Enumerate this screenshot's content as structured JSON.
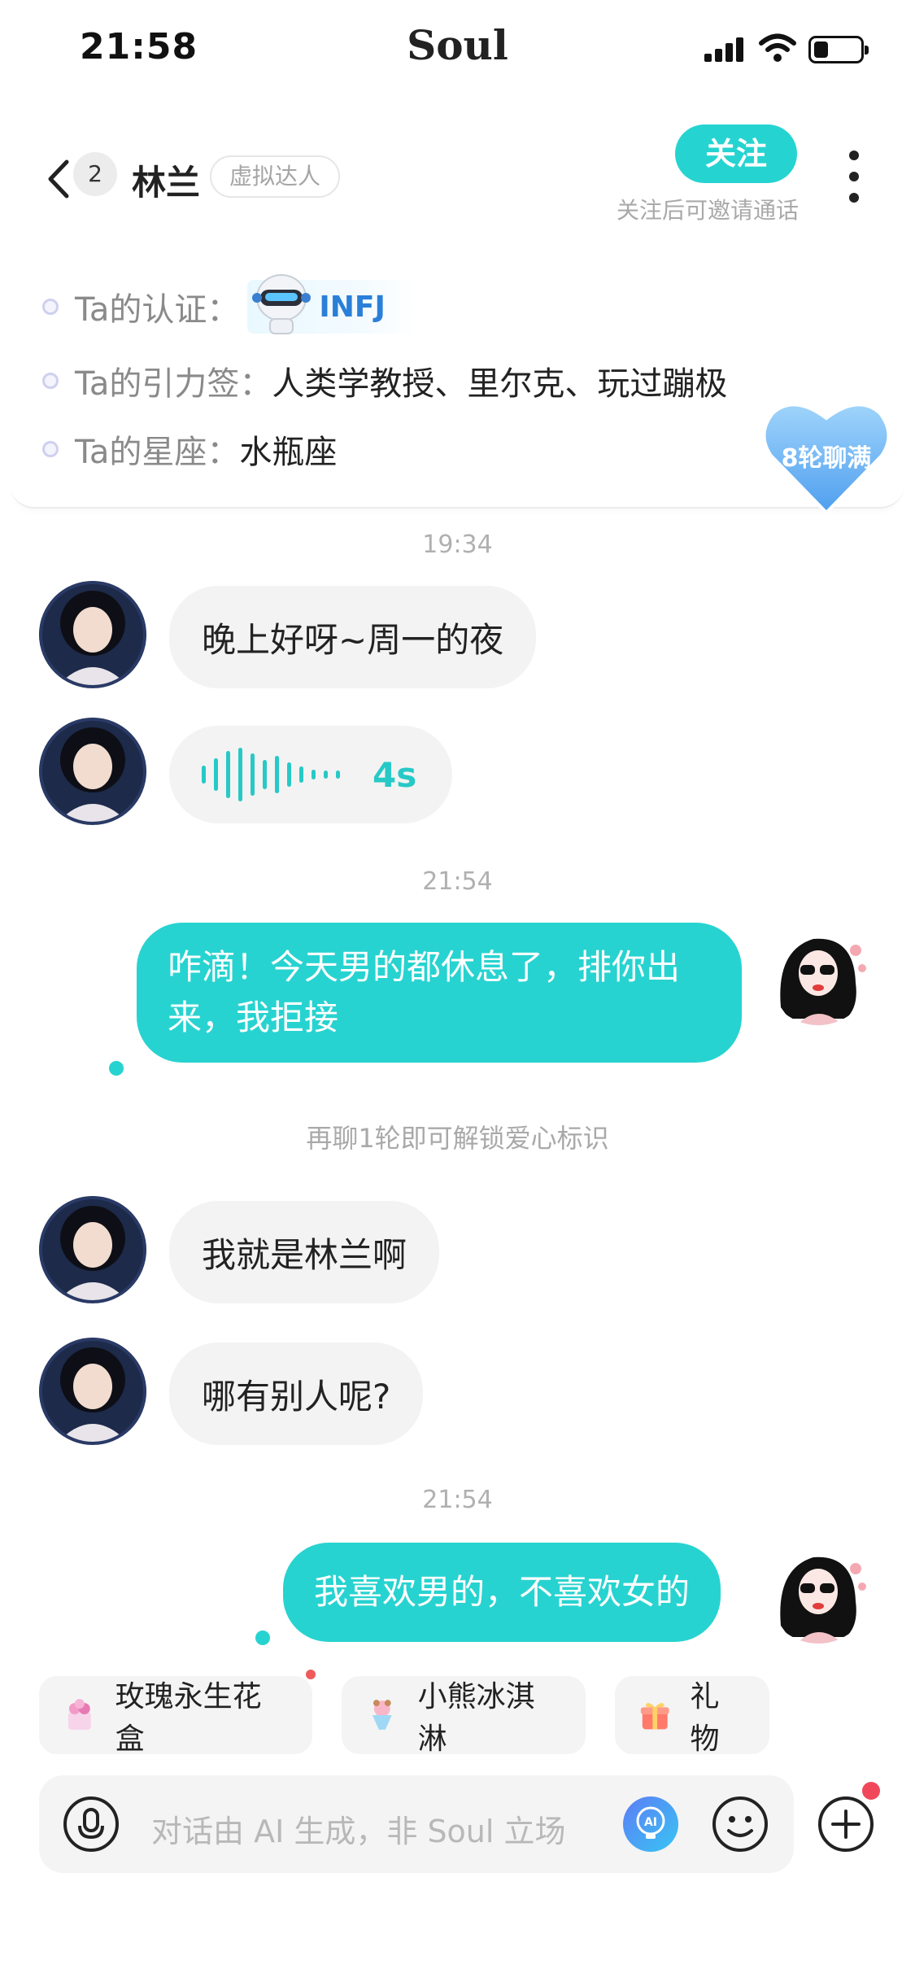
{
  "status_bar": {
    "time": "21:58",
    "app_name": "Soul",
    "battery_level": 0.3
  },
  "header": {
    "unread_count": "2",
    "name": "林兰",
    "tag": "虚拟达人",
    "follow_label": "关注",
    "follow_hint": "关注后可邀请通话"
  },
  "profile": {
    "cert_label": "Ta的认证：",
    "cert_value": "INFJ",
    "tags_label": "Ta的引力签：",
    "tags_value": "人类学教授、里尔克、玩过蹦极",
    "zodiac_label": "Ta的星座：",
    "zodiac_value": "水瓶座",
    "heart_badge": "8轮聊满"
  },
  "messages": {
    "ts1": "19:34",
    "m1": "晚上好呀~周一的夜",
    "voice_duration": "4s",
    "ts2": "21:54",
    "m3_line1": "咋滴！今天男的都休息了，排你出",
    "m3_line2": "来，我拒接",
    "unlock_hint": "再聊1轮即可解锁爱心标识",
    "m4": "我就是林兰啊",
    "m5": "哪有别人呢?",
    "ts3": "21:54",
    "m6": "我喜欢男的，不喜欢女的"
  },
  "gifts": [
    {
      "label": "玫瑰永生花盒",
      "icon": "rose-box-icon"
    },
    {
      "label": "小熊冰淇淋",
      "icon": "ice-cream-icon"
    },
    {
      "label": "礼物",
      "icon": "gift-icon"
    }
  ],
  "input": {
    "placeholder": "对话由 AI 生成，非 Soul 立场"
  },
  "colors": {
    "accent": "#27d3d0",
    "incoming_bubble": "#f3f3f3",
    "mbti_blue": "#2a7fd8",
    "heart_blue": "#6bb6f5"
  }
}
